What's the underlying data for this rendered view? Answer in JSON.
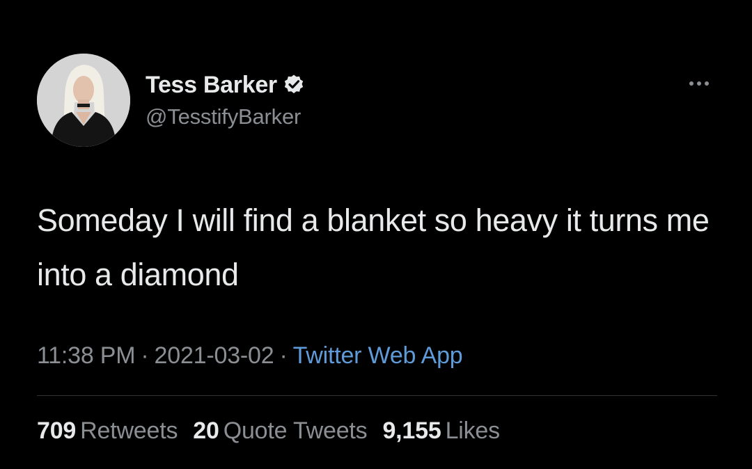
{
  "author": {
    "display_name": "Tess Barker",
    "handle": "@TesstifyBarker",
    "verified": true,
    "verified_icon": "verified-badge-icon"
  },
  "tweet": {
    "text": "Someday I will find a blanket so heavy it turns me into a diamond",
    "time": "11:38 PM",
    "date": "2021-03-02",
    "separator": "·",
    "source": "Twitter Web App"
  },
  "stats": {
    "retweets_count": "709",
    "retweets_label": "Retweets",
    "quotes_count": "20",
    "quotes_label": "Quote Tweets",
    "likes_count": "9,155",
    "likes_label": "Likes"
  },
  "colors": {
    "background": "#000000",
    "primary_text": "#e7e9ea",
    "secondary_text": "#8b8f94",
    "link": "#5f9ad9",
    "divider": "#2f3336"
  }
}
